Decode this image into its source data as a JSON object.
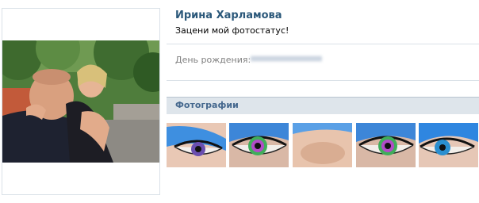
{
  "profile": {
    "name": "Ирина Харламова",
    "status": "Зацени мой фотостатус!"
  },
  "info": {
    "birthday_label": "День рождения:"
  },
  "photos": {
    "title": "Фотографии",
    "thumbnails": [
      {
        "icon": "blue-eye-makeup-photo",
        "iris": "#6a4fb0"
      },
      {
        "icon": "rainbow-iris-eye-photo",
        "iris": "#3fae5a"
      },
      {
        "icon": "blue-eyeshadow-skin-photo",
        "iris": null
      },
      {
        "icon": "rainbow-iris-eye-photo",
        "iris": "#3fae5a"
      },
      {
        "icon": "blue-eye-makeup-photo",
        "iris": "#2a8fd0"
      }
    ]
  },
  "colors": {
    "link": "#2b587a",
    "header_bg": "#dee5eb",
    "header_text": "#45688e",
    "label": "#7f7f7f"
  }
}
